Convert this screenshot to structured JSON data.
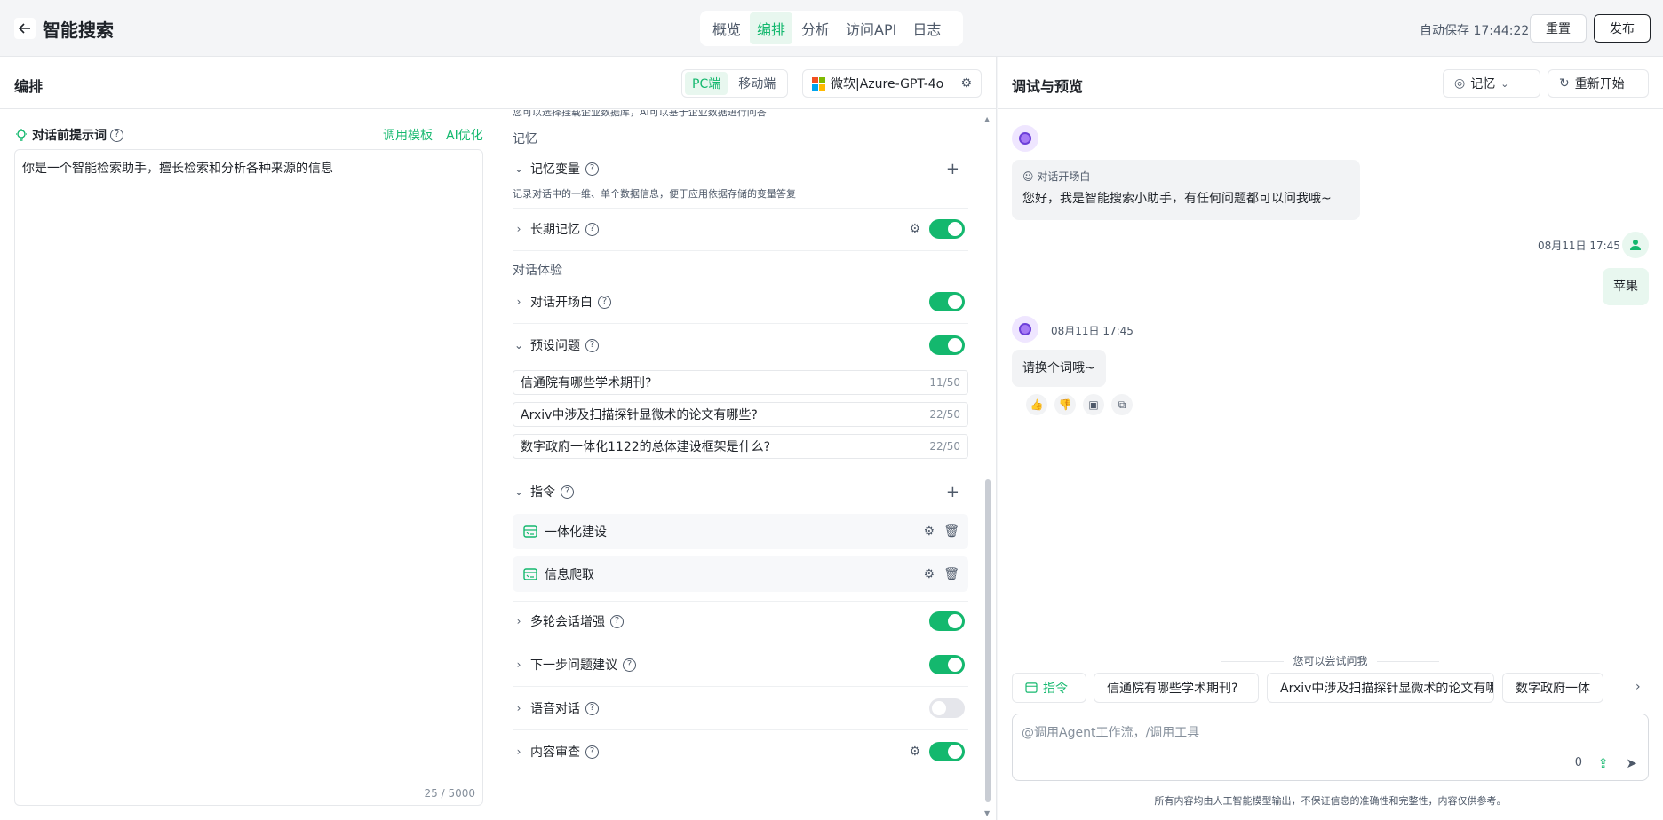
{
  "header": {
    "back_icon": "arrow-left-icon",
    "title": "智能搜索",
    "tabs": [
      "概览",
      "编排",
      "分析",
      "访问API",
      "日志"
    ],
    "active_tab": "编排",
    "autosave": "自动保存 17:44:22",
    "reset_label": "重置",
    "publish_label": "发布"
  },
  "editor": {
    "title": "编排",
    "platforms": [
      "PC端",
      "移动端"
    ],
    "active_platform": "PC端",
    "model": "微软|Azure-GPT-4o"
  },
  "prompt": {
    "label": "对话前提示词",
    "template_link": "调用模板",
    "ai_optimize_link": "AI优化",
    "value": "你是一个智能检索助手，擅长检索和分析各种来源的信息",
    "counter": "25 / 5000"
  },
  "config": {
    "truncated_text": "您可以选择挂载企业数据库，AI可以基于企业数据进行问答",
    "memory_section": "记忆",
    "memory_var_label": "记忆变量",
    "memory_var_desc": "记录对话中的一维、单个数据信息，便于应用依据存储的变量答复",
    "long_memory_label": "长期记忆",
    "experience_section": "对话体验",
    "opening_label": "对话开场白",
    "preset_label": "预设问题",
    "preset_questions": [
      {
        "text": "信通院有哪些学术期刊?",
        "count": "11/50"
      },
      {
        "text": "Arxiv中涉及扫描探针显微术的论文有哪些?",
        "count": "22/50"
      },
      {
        "text": "数字政府一体化1122的总体建设框架是什么?",
        "count": "22/50"
      }
    ],
    "commands_label": "指令",
    "commands": [
      "一体化建设",
      "信息爬取"
    ],
    "multi_turn_label": "多轮会话增强",
    "next_suggest_label": "下一步问题建议",
    "voice_label": "语音对话",
    "audit_label": "内容审查",
    "toggles": {
      "long_memory": true,
      "opening": true,
      "preset": true,
      "multi_turn": true,
      "next_suggest": true,
      "voice": false,
      "audit": true
    }
  },
  "preview": {
    "title": "调试与预览",
    "memory_btn": "记忆",
    "restart_btn": "重新开始",
    "opening_tag": "对话开场白",
    "opening_msg": "您好，我是智能搜索小助手，有任何问题都可以问我哦~",
    "user_time": "08月11日 17:45",
    "user_msg": "苹果",
    "bot_time": "08月11日 17:45",
    "bot_msg": "请换个词哦~",
    "try_label": "您可以尝试问我",
    "chip_command": "指令",
    "chips": [
      "信通院有哪些学术期刊?",
      "Arxiv中涉及扫描探针显微术的论文有哪些?",
      "数字政府一体"
    ],
    "input_placeholder": "@调用Agent工作流，/调用工具",
    "input_count": "0",
    "disclaimer": "所有内容均由人工智能模型输出，不保证信息的准确性和完整性，内容仅供参考。"
  },
  "colors": {
    "accent": "#14b86e",
    "accent_light": "#e8f7ef",
    "bot_avatar": "#a77bf5"
  }
}
